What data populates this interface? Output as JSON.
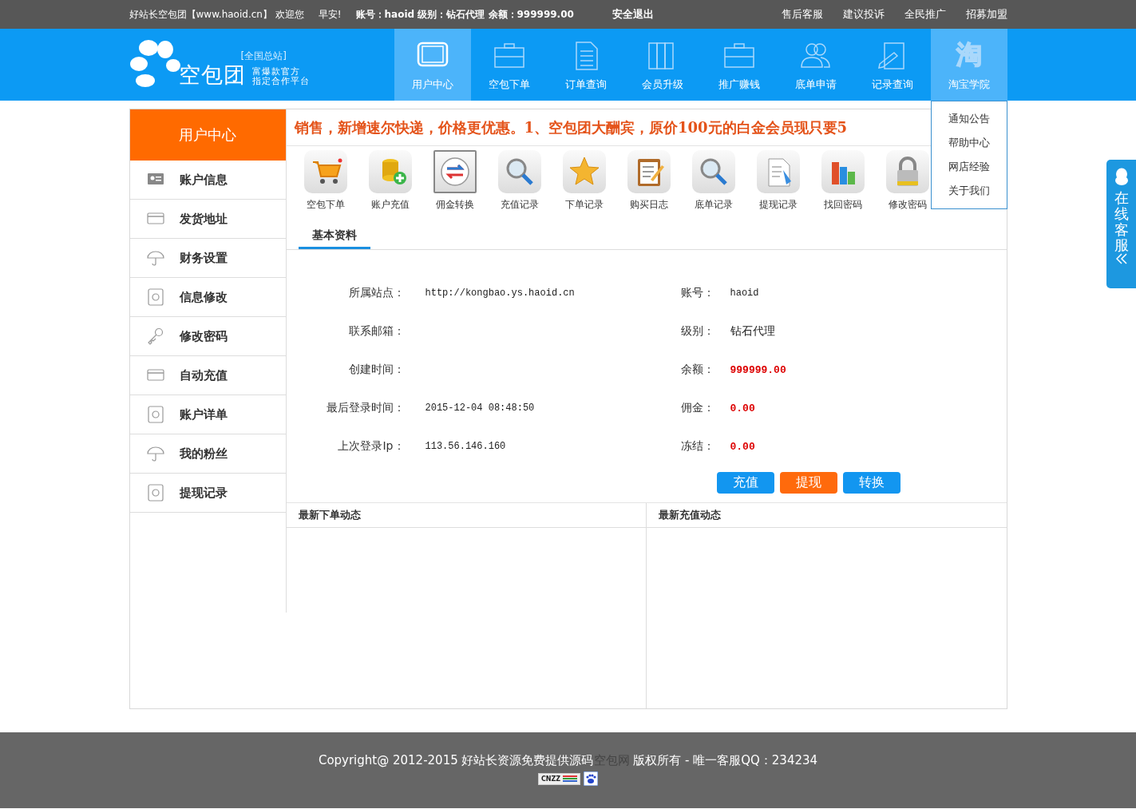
{
  "top_bar": {
    "greeting": "好站长空包团【www.haoid.cn】 欢迎您",
    "time_greeting": "早安!",
    "account_info": "账号：haoid 级别：钻石代理 余额：999999.00",
    "logout": "安全退出",
    "links": [
      "售后客服",
      "建议投诉",
      "全民推广",
      "招募加盟"
    ]
  },
  "header": {
    "logo_name": "空包团",
    "logo_badge": "[全国总站]",
    "tagline_1": "富爆款官方",
    "tagline_2": "指定合作平台"
  },
  "nav": [
    {
      "label": "用户中心",
      "selected": true,
      "expanded": false
    },
    {
      "label": "空包下单",
      "selected": false,
      "expanded": false
    },
    {
      "label": "订单查询",
      "selected": false,
      "expanded": false
    },
    {
      "label": "会员升级",
      "selected": false,
      "expanded": false
    },
    {
      "label": "推广赚钱",
      "selected": false,
      "expanded": false
    },
    {
      "label": "底单申请",
      "selected": false,
      "expanded": false
    },
    {
      "label": "记录查询",
      "selected": false,
      "expanded": false
    },
    {
      "label": "淘宝学院",
      "selected": false,
      "expanded": true,
      "icon_text": "淘"
    }
  ],
  "dropdown": [
    "通知公告",
    "帮助中心",
    "网店经验",
    "关于我们"
  ],
  "sidebar": {
    "title": "用户中心",
    "items": [
      "账户信息",
      "发货地址",
      "财务设置",
      "信息修改",
      "修改密码",
      "自动充值",
      "账户详单",
      "我的粉丝",
      "提现记录"
    ]
  },
  "notice": "销售，新增速尔快递，价格更优惠。1、空包团大酬宾，原价100元的白金会员现只要5",
  "quick_links": [
    {
      "label": "空包下单",
      "selected": false
    },
    {
      "label": "账户充值",
      "selected": false
    },
    {
      "label": "佣金转换",
      "selected": true
    },
    {
      "label": "充值记录",
      "selected": false
    },
    {
      "label": "下单记录",
      "selected": false
    },
    {
      "label": "购买日志",
      "selected": false
    },
    {
      "label": "底单记录",
      "selected": false
    },
    {
      "label": "提现记录",
      "selected": false
    },
    {
      "label": "找回密码",
      "selected": false
    },
    {
      "label": "修改密码",
      "selected": false
    }
  ],
  "tabs": [
    {
      "label": "基本资料",
      "selected": true
    }
  ],
  "info_left": [
    {
      "label": "所属站点：",
      "value": "http://kongbao.ys.haoid.cn"
    },
    {
      "label": "联系邮箱："
    },
    {
      "label": "创建时间："
    },
    {
      "label": "最后登录时间：",
      "value": "2015-12-04 08:48:50"
    },
    {
      "label": "上次登录Ip：",
      "value": "113.56.146.160"
    }
  ],
  "info_right": [
    {
      "label": "账号：",
      "value": "haoid",
      "kind": "code"
    },
    {
      "label": "级别：",
      "value": "钻石代理",
      "kind": "text"
    },
    {
      "label": "余额：",
      "value": "999999.00",
      "kind": "amount"
    },
    {
      "label": "佣金：",
      "value": "0.00",
      "kind": "amount"
    },
    {
      "label": "冻结：",
      "value": "0.00",
      "kind": "amount"
    }
  ],
  "actions": [
    {
      "label": "充值",
      "color": "#1296f0"
    },
    {
      "label": "提现",
      "color": "#ff6a0c"
    },
    {
      "label": "转换",
      "color": "#1296f0"
    }
  ],
  "panels": [
    "最新下单动态",
    "最新充值动态"
  ],
  "service": {
    "label": "在线客服"
  },
  "footer": {
    "copyright_before": "Copyright@ 2012-2015 好站长资源免费提供源码",
    "copyright_site": "空包网",
    "copyright_after": " 版权所有 - 唯一客服QQ：234234",
    "badge": "CNZZ"
  }
}
